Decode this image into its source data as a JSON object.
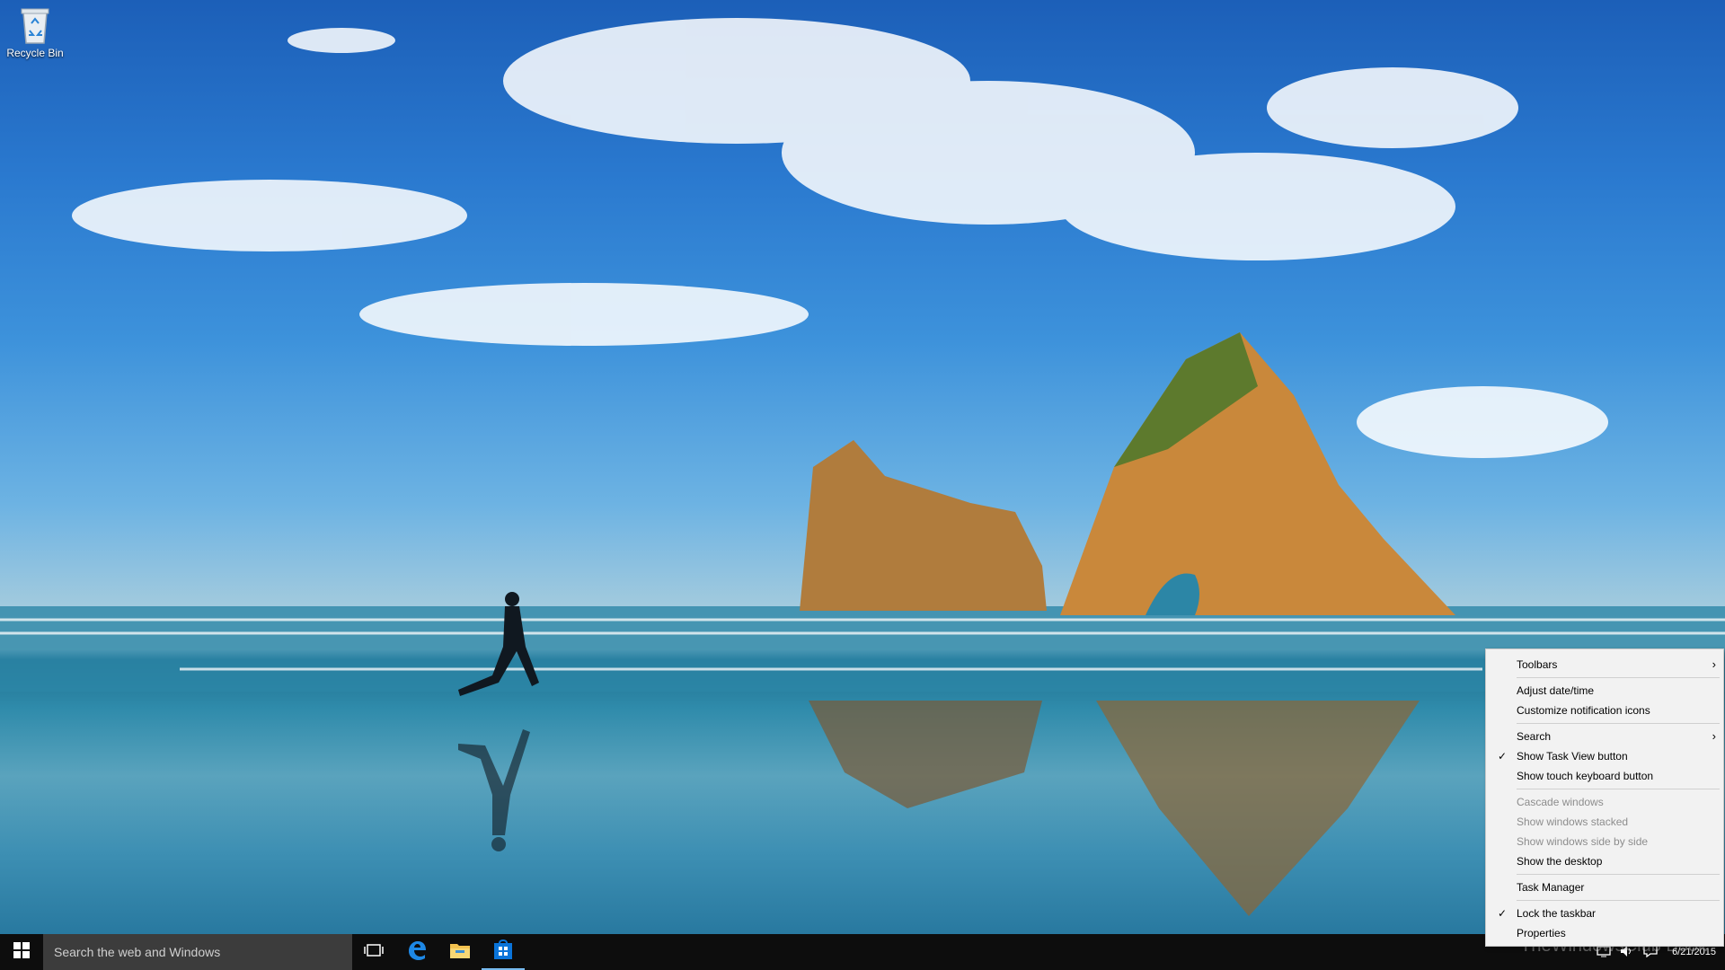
{
  "desktop": {
    "icons": [
      {
        "label": "Recycle Bin",
        "icon": "recycle-bin-icon"
      }
    ]
  },
  "taskbar": {
    "start_icon": "windows-logo-icon",
    "search_placeholder": "Search the web and Windows",
    "pinned": [
      {
        "name": "task-view",
        "icon": "task-view-icon"
      },
      {
        "name": "edge",
        "icon": "edge-icon"
      },
      {
        "name": "file-explorer",
        "icon": "folder-icon"
      },
      {
        "name": "store",
        "icon": "store-icon"
      }
    ],
    "date": "6/21/2015",
    "watermark": "TheWindowsClub Book"
  },
  "context_menu": {
    "items": [
      {
        "label": "Toolbars",
        "submenu": true,
        "checked": false,
        "disabled": false
      },
      {
        "separator": true
      },
      {
        "label": "Adjust date/time",
        "checked": false,
        "disabled": false
      },
      {
        "label": "Customize notification icons",
        "checked": false,
        "disabled": false
      },
      {
        "separator": true
      },
      {
        "label": "Search",
        "submenu": true,
        "checked": false,
        "disabled": false
      },
      {
        "label": "Show Task View button",
        "checked": true,
        "disabled": false
      },
      {
        "label": "Show touch keyboard button",
        "checked": false,
        "disabled": false
      },
      {
        "separator": true
      },
      {
        "label": "Cascade windows",
        "checked": false,
        "disabled": true
      },
      {
        "label": "Show windows stacked",
        "checked": false,
        "disabled": true
      },
      {
        "label": "Show windows side by side",
        "checked": false,
        "disabled": true
      },
      {
        "label": "Show the desktop",
        "checked": false,
        "disabled": false
      },
      {
        "separator": true
      },
      {
        "label": "Task Manager",
        "checked": false,
        "disabled": false
      },
      {
        "separator": true
      },
      {
        "label": "Lock the taskbar",
        "checked": true,
        "disabled": false
      },
      {
        "label": "Properties",
        "checked": false,
        "disabled": false
      }
    ],
    "check_glyph": "✓",
    "arrow_glyph": "›"
  },
  "colors": {
    "taskbar_bg": "#0d0d0d",
    "search_bg": "#3c3c3c",
    "menu_bg": "#f2f2f2",
    "accent": "#76b9ed"
  }
}
